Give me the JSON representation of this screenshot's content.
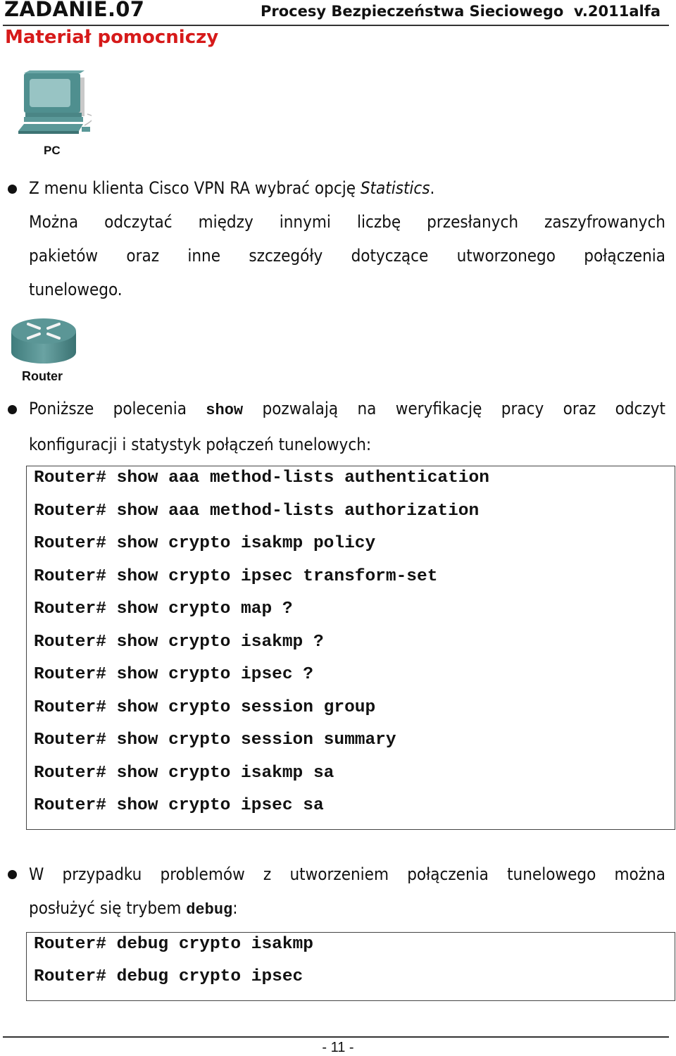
{
  "header": {
    "task_label": "ZADANIE.07",
    "course_title": "Procesy Bezpieczeństwa Sieciowego  v.2011alfa"
  },
  "subtitle": "Materiał pomocniczy",
  "devices": {
    "pc": {
      "icon": "pc-icon",
      "label": "PC"
    },
    "router": {
      "icon": "router-icon",
      "label": "Router"
    }
  },
  "section1": {
    "line1_prefix": "Z menu klienta Cisco VPN RA wybrać opcję ",
    "line1_option": "Statistics",
    "line1_suffix": ".",
    "line2": "Można odczytać między innymi liczbę przesłanych zaszyfrowanych",
    "line3": "pakietów oraz inne szczegóły dotyczące utworzonego połączenia",
    "line4": "tunelowego."
  },
  "section2": {
    "line1_prefix": "Poniższe polecenia ",
    "line1_cmd": "show",
    "line1_suffix": " pozwalają na weryfikację pracy oraz odczyt",
    "line2": "konfiguracji i statystyk połączeń tunelowych:",
    "commands": [
      "Router# show aaa method-lists authentication",
      "Router# show aaa method-lists authorization",
      "Router# show crypto isakmp policy",
      "Router# show crypto ipsec transform-set",
      "Router# show crypto map ?",
      "Router# show crypto isakmp ?",
      "Router# show crypto ipsec ?",
      "Router# show crypto session group",
      "Router# show crypto session summary",
      "Router# show crypto isakmp sa",
      "Router# show crypto ipsec sa"
    ]
  },
  "section3": {
    "line1": "W przypadku problemów z utworzeniem połączenia tunelowego można",
    "line2_prefix": "posłużyć się trybem ",
    "line2_cmd": "debug",
    "line2_suffix": ":",
    "commands": [
      "Router# debug crypto isakmp",
      "Router# debug crypto ipsec"
    ]
  },
  "footer": {
    "page_number": "- 11 -"
  }
}
